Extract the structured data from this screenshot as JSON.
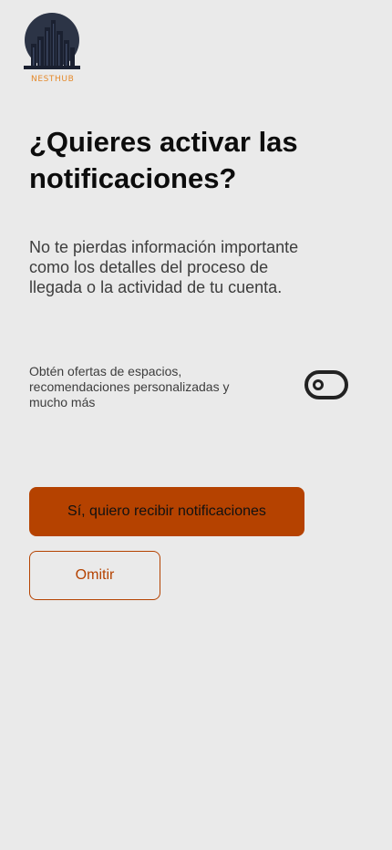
{
  "brand": {
    "name": "NESTHUB",
    "logo_icon": "city-skyline-logo",
    "accent_color": "#e58a2b"
  },
  "content": {
    "title": "¿Quieres activar las notificaciones?",
    "description": "No te pierdas información importante como los detalles del proceso de llegada o la actividad de tu cuenta.",
    "offer_text": "Obtén ofertas de espacios, recomendaciones personalizadas y mucho más",
    "offer_toggle_on": false
  },
  "actions": {
    "accept_label": "Sí, quiero recibir notificaciones",
    "skip_label": "Omitir",
    "primary_color": "#b54200"
  }
}
